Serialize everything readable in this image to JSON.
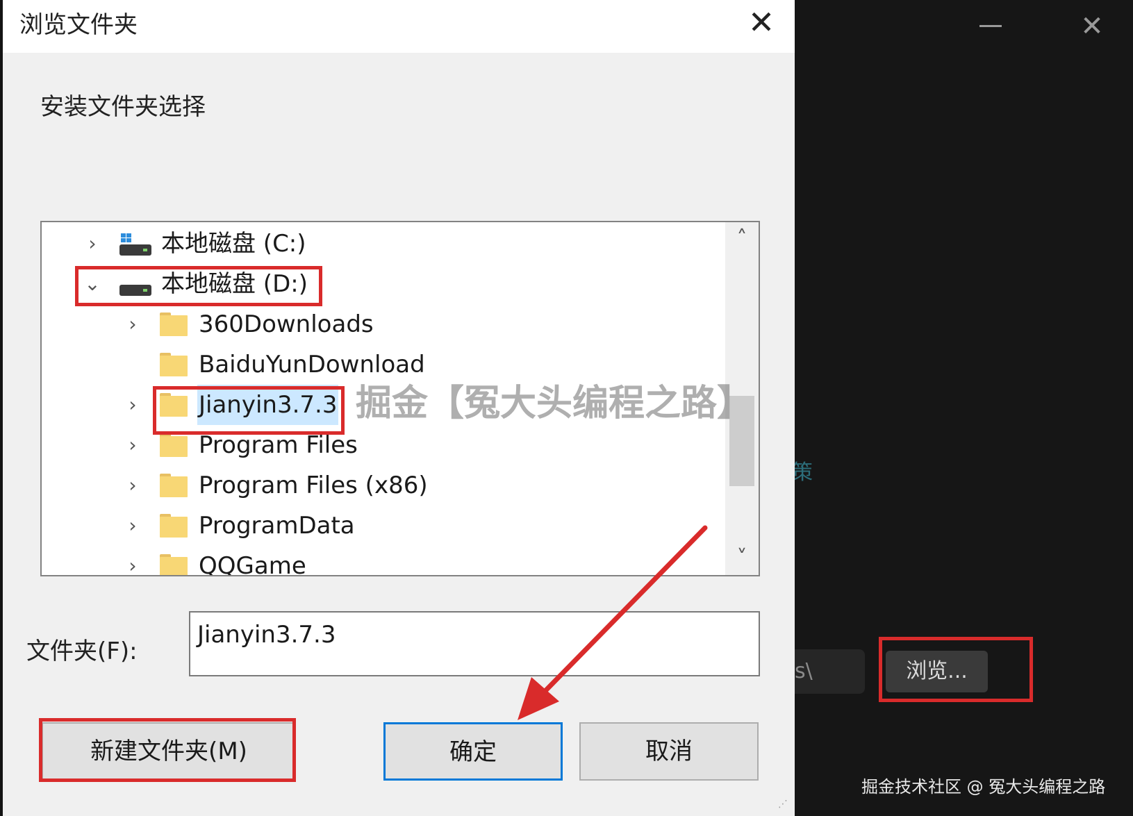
{
  "background_app": {
    "minimize_icon": "minimize-icon",
    "close_icon": "close-icon",
    "close_glyph": "✕",
    "path_fragment": "s\\",
    "browse_label": "浏览...",
    "teal_text": "策",
    "footer_watermark": "掘金技术社区 @ 冤大头编程之路"
  },
  "dialog": {
    "title": "浏览文件夹",
    "close_glyph": "✕",
    "description": "安装文件夹选择",
    "tree": {
      "items": [
        {
          "label": "本地磁盘 (C:)",
          "icon": "drive-icon",
          "expanded": false
        },
        {
          "label": "本地磁盘 (D:)",
          "icon": "drive-icon",
          "expanded": true
        },
        {
          "label": "360Downloads",
          "icon": "folder-icon",
          "expanded": false
        },
        {
          "label": "BaiduYunDownload",
          "icon": "folder-icon",
          "expanded": false
        },
        {
          "label": "Jianyin3.7.3",
          "icon": "folder-icon",
          "expanded": false,
          "selected": true
        },
        {
          "label": "Program Files",
          "icon": "folder-icon",
          "expanded": false
        },
        {
          "label": "Program Files (x86)",
          "icon": "folder-icon",
          "expanded": false
        },
        {
          "label": "ProgramData",
          "icon": "folder-icon",
          "expanded": false
        },
        {
          "label": "QQGame",
          "icon": "folder-icon",
          "expanded": false
        }
      ]
    },
    "folder_label": "文件夹(F):",
    "folder_value": "Jianyin3.7.3",
    "new_folder_button": "新建文件夹(M)",
    "ok_button": "确定",
    "cancel_button": "取消"
  },
  "overlay_watermark": "掘金【冤大头编程之路】",
  "colors": {
    "annotation_red": "#d92b2b",
    "accent_blue": "#0078d7",
    "selection": "#cce8ff",
    "folder_yellow": "#f8d775"
  }
}
